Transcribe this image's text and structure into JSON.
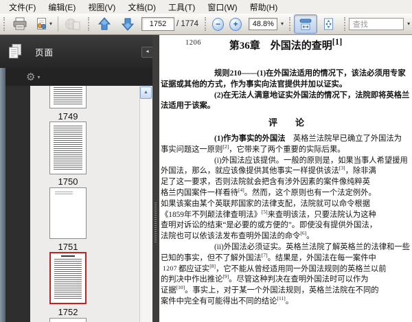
{
  "menu_bar": {
    "items": [
      "文件(F)",
      "编辑(E)",
      "视图(V)",
      "文档(D)",
      "工具(T)",
      "窗口(W)",
      "帮助(H)"
    ]
  },
  "toolbar": {
    "buttons": [
      "print",
      "collaborate",
      "email-disabled",
      "previous-page",
      "next-page",
      "zoom-out",
      "zoom-in",
      "fit-width",
      "fit-page"
    ],
    "fit_width_active": true,
    "page_current": "1752",
    "page_total_label": "/ 1774",
    "zoom_value": "48.8%",
    "zoom_out_glyph": "−",
    "zoom_in_glyph": "+",
    "find_placeholder": "查找"
  },
  "icons": {
    "options_gear": "⚙",
    "dropdown_caret": "▾",
    "collapse_panel": "◂",
    "scroll_up": "▲"
  },
  "sidebar": {
    "panel_title": "页面",
    "thumbnails": [
      {
        "label": "1749",
        "state": "partially-scrolled"
      },
      {
        "label": "1750",
        "state": "normal"
      },
      {
        "label": "1751",
        "state": "mostly-blank"
      },
      {
        "label": "1752",
        "state": "selected",
        "selection_color": "#c42020"
      }
    ]
  },
  "document": {
    "corner_page_number": "1206",
    "margin_page_number": "1207",
    "title": "第36章　外国法的查明[1]",
    "lines": [
      {
        "t": "**规则210——(1)在外国法适用的情况下，该法必须用专家**",
        "indent": true
      },
      {
        "t": "**证据或其他的方式，作为事实向法官提供并加以证实。**"
      },
      {
        "t": "**(2)在无法人满意地证实外国法的情况下，法院即将英格兰**",
        "indent": true
      },
      {
        "t": "**法适用于该案。**"
      },
      {
        "t": "评　　论",
        "heading": true
      },
      {
        "t": "**(1)作为事实的外国法**　英格兰法院早已确立了外国法为",
        "indent": true
      },
      {
        "t": "事实问题这一原则[2]，它带来了两个重要的实际后果。"
      },
      {
        "t": "(i)外国法应该提供。一般的原则是，如果当事人希望援用",
        "indent": true
      },
      {
        "t": "外国法，那么，就应该像提供其他事实一样提供该法[3]，除非满"
      },
      {
        "t": "足了这一要求，否则法院就会把含有涉外因素的案件像纯粹英"
      },
      {
        "t": "格兰内国案件一样看待[4]。然而，这个原则也有一个法定例外。"
      },
      {
        "t": "如果该案由某个英联邦国家的法律支配，法院就可以命令根据"
      },
      {
        "t": "《1859年不列颠法律查明法》[5]来查明该法，只要法院认为这种"
      },
      {
        "t": "查明对诉讼的结束“是必要的或方便的”。即使没有提供外国法，"
      },
      {
        "t": "法院也可以依该法发布查明外国法的命令[6]。"
      },
      {
        "t": "(ii)外国法必须证实。英格兰法院了解英格兰的法律和一些",
        "indent": true
      },
      {
        "t": "已知的事实，但不了解外国法[7]。结果是，外国法在每一案件中"
      },
      {
        "t": "都应证实[8]，它不能从曾经适用同一外国法规则的英格兰以前",
        "note": "1207",
        "pad": 26
      },
      {
        "t": "的判决中作出推论[9]。尽管这种判决在查明外国法时可以作为"
      },
      {
        "t": "证据[10]。事实上，对于某一个外国法规则，英格兰法院在不同的"
      },
      {
        "t": "案件中完全有可能得出不同的结论[11]。"
      }
    ]
  }
}
